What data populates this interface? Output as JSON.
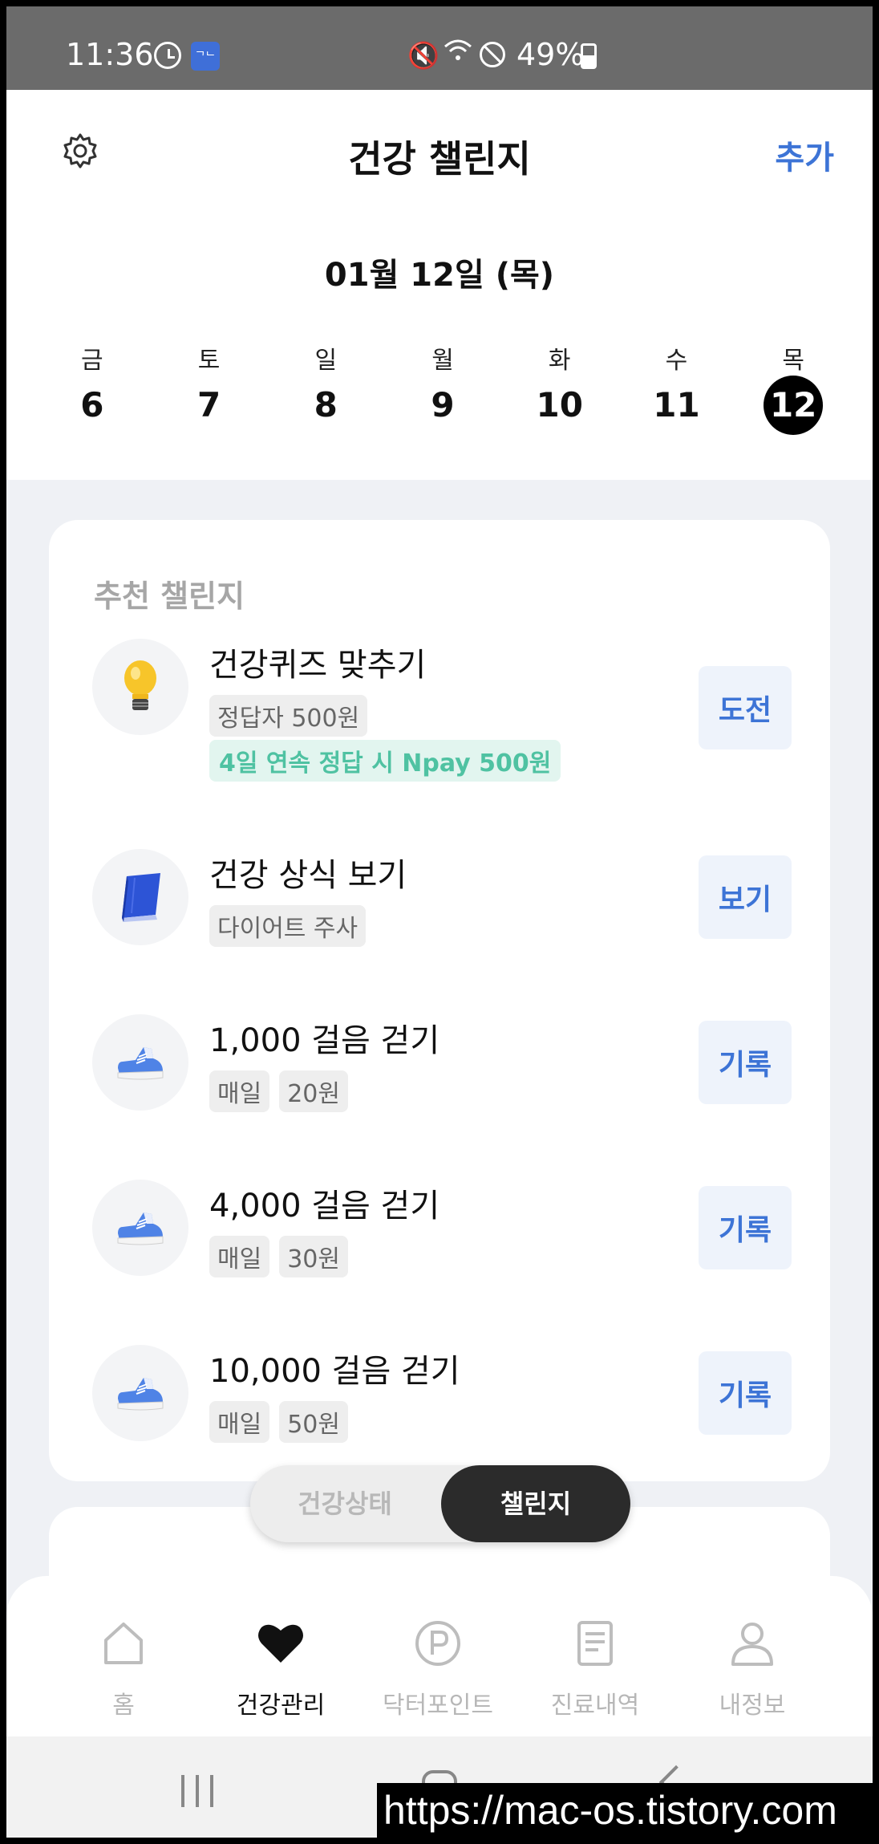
{
  "status_bar": {
    "time": "11:36",
    "app_badge": "ᄀᄂ",
    "battery": "49%"
  },
  "header": {
    "title": "건강 챌린지",
    "add_label": "추가",
    "date": "01월 12일 (목)",
    "week": [
      {
        "name": "금",
        "num": "6"
      },
      {
        "name": "토",
        "num": "7"
      },
      {
        "name": "일",
        "num": "8"
      },
      {
        "name": "월",
        "num": "9"
      },
      {
        "name": "화",
        "num": "10"
      },
      {
        "name": "수",
        "num": "11"
      },
      {
        "name": "목",
        "num": "12"
      }
    ]
  },
  "recommend": {
    "label": "추천 챌린지",
    "items": [
      {
        "icon": "lightbulb-icon",
        "title": "건강퀴즈 맞추기",
        "tags": [
          "정답자 500원"
        ],
        "promo": "4일 연속 정답 시 Npay 500원",
        "button": "도전"
      },
      {
        "icon": "book-icon",
        "title": "건강 상식 보기",
        "tags": [
          "다이어트 주사"
        ],
        "button": "보기"
      },
      {
        "icon": "sneaker-icon",
        "title": "1,000 걸음 걷기",
        "tags": [
          "매일",
          "20원"
        ],
        "button": "기록"
      },
      {
        "icon": "sneaker-icon",
        "title": "4,000 걸음 걷기",
        "tags": [
          "매일",
          "30원"
        ],
        "button": "기록"
      },
      {
        "icon": "sneaker-icon",
        "title": "10,000 걸음 걷기",
        "tags": [
          "매일",
          "50원"
        ],
        "button": "기록"
      }
    ]
  },
  "toggle": {
    "off_label": "건강상태",
    "on_label": "챌린지"
  },
  "bottom_nav": [
    {
      "label": "홈"
    },
    {
      "label": "건강관리"
    },
    {
      "label": "닥터포인트"
    },
    {
      "label": "진료내역"
    },
    {
      "label": "내정보"
    }
  ],
  "watermark": "https://mac-os.tistory.com",
  "colors": {
    "accent": "#3d74d6",
    "promo": "#4fc2a2",
    "selected_day": "#000000",
    "background": "#eff1f5"
  }
}
